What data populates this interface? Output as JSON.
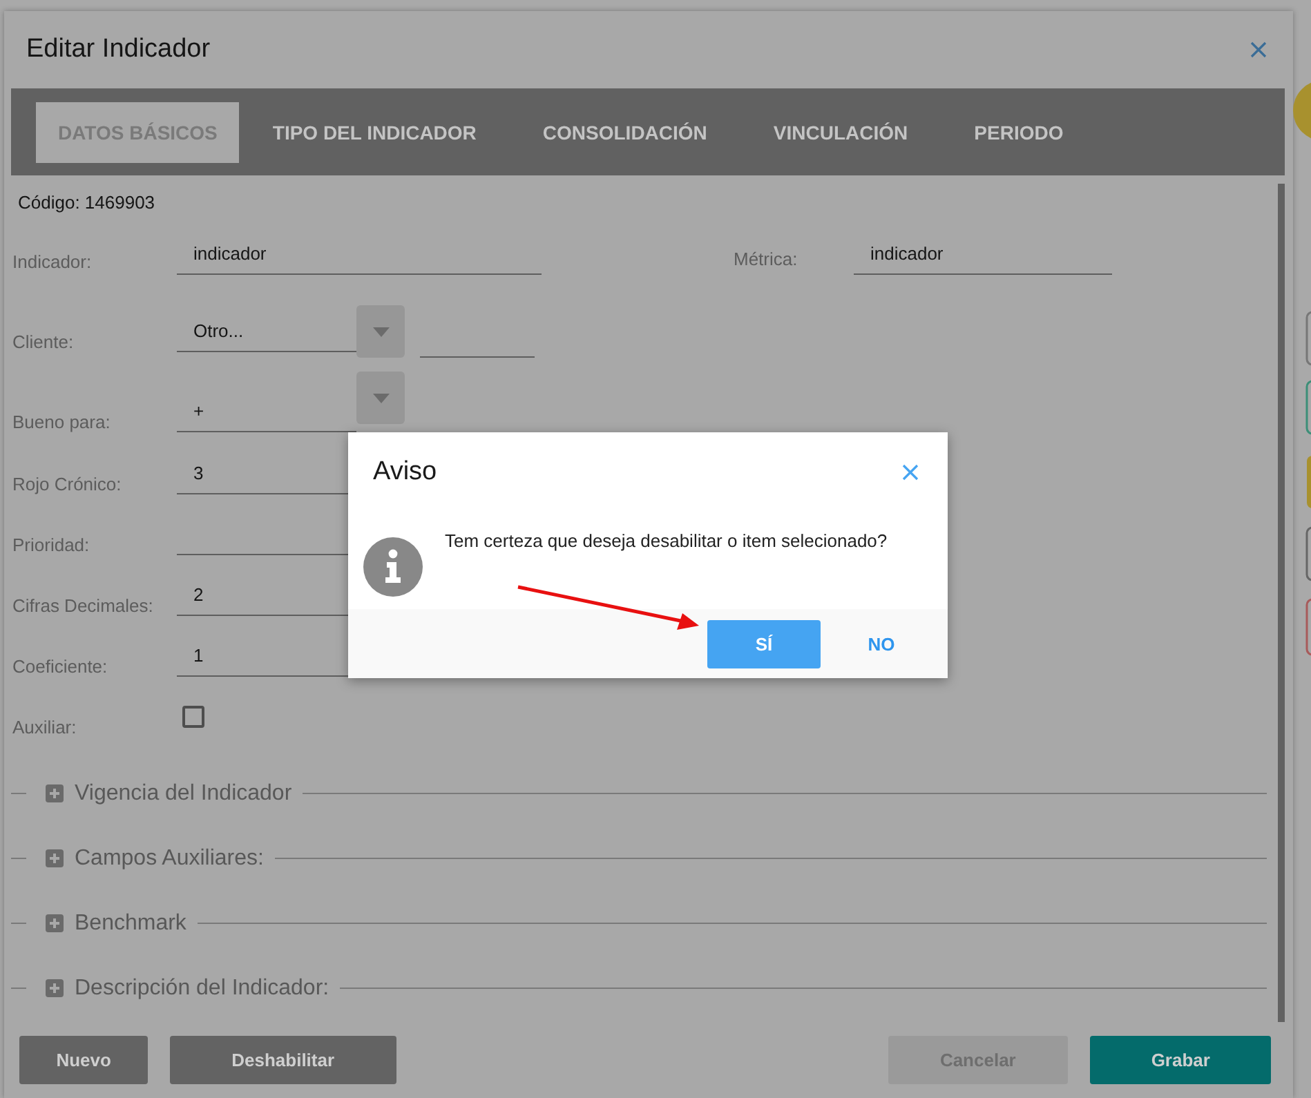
{
  "window": {
    "title": "Editar Indicador"
  },
  "tabs": [
    {
      "label": "DATOS BÁSICOS",
      "selected": true
    },
    {
      "label": "TIPO DEL INDICADOR",
      "selected": false
    },
    {
      "label": "CONSOLIDACIÓN",
      "selected": false
    },
    {
      "label": "VINCULACIÓN",
      "selected": false
    },
    {
      "label": "PERIODO",
      "selected": false
    }
  ],
  "code": "Código: 1469903",
  "fields": [
    {
      "kind": "text",
      "label": "Indicador:",
      "value": "indicador",
      "side_label": "Métrica:",
      "side_value": "indicador"
    },
    {
      "kind": "select_extra",
      "label": "Cliente:",
      "value": "Otro..."
    },
    {
      "kind": "select",
      "label": "Bueno para:",
      "value": "+"
    },
    {
      "kind": "text",
      "label": "Rojo Crónico:",
      "value": "3"
    },
    {
      "kind": "text",
      "label": "Prioridad:"
    },
    {
      "kind": "text",
      "label": "Cifras Decimales:",
      "value": "2"
    },
    {
      "kind": "text",
      "label": "Coeficiente:",
      "value": "1"
    },
    {
      "kind": "checkbox",
      "label": "Auxiliar:",
      "checked": false
    }
  ],
  "sections": [
    {
      "label": "Vigencia del Indicador",
      "expanded": false
    },
    {
      "label": "Campos Auxiliares:",
      "expanded": false
    },
    {
      "label": "Benchmark",
      "expanded": false
    },
    {
      "label": "Descripción del Indicador:",
      "expanded": false
    }
  ],
  "footer_buttons": [
    {
      "label": "Nuevo",
      "kind": "dark"
    },
    {
      "label": "Deshabilitar",
      "kind": "dark"
    },
    {
      "label": "Cancelar",
      "kind": "disabled"
    },
    {
      "label": "Grabar",
      "kind": "primary"
    }
  ],
  "alert": {
    "title": "Aviso",
    "message": "Tem certeza que deseja desabilitar o item selecionado?",
    "buttons": [
      {
        "label": "SÍ",
        "kind": "primary"
      },
      {
        "label": "NO",
        "kind": "text"
      }
    ]
  }
}
